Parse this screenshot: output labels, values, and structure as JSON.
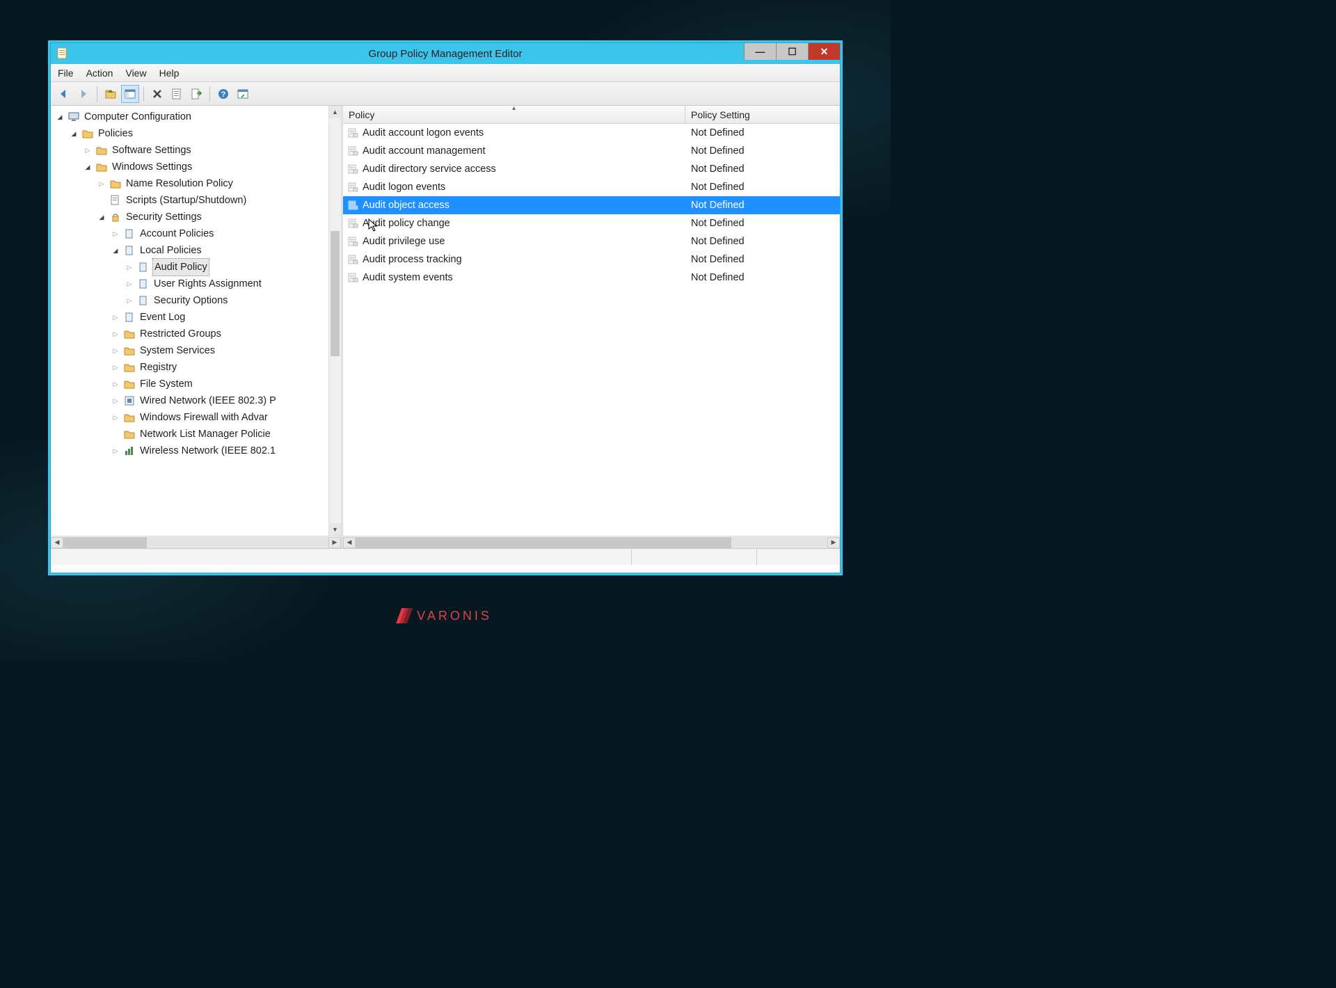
{
  "window": {
    "title": "Group Policy Management Editor"
  },
  "menu": {
    "file": "File",
    "action": "Action",
    "view": "View",
    "help": "Help"
  },
  "tree": {
    "root": "Computer Configuration",
    "policies": "Policies",
    "software": "Software Settings",
    "windows": "Windows Settings",
    "nameres": "Name Resolution Policy",
    "scripts": "Scripts (Startup/Shutdown)",
    "security": "Security Settings",
    "account": "Account Policies",
    "local": "Local Policies",
    "audit": "Audit Policy",
    "userrights": "User Rights Assignment",
    "secoptions": "Security Options",
    "eventlog": "Event Log",
    "restricted": "Restricted Groups",
    "sysservices": "System Services",
    "registry": "Registry",
    "filesystem": "File System",
    "wired": "Wired Network (IEEE 802.3) P",
    "firewall": "Windows Firewall with Advar",
    "netlist": "Network List Manager Policie",
    "wireless": "Wireless Network (IEEE 802.1"
  },
  "list": {
    "header_policy": "Policy",
    "header_setting": "Policy Setting",
    "rows": [
      {
        "name": "Audit account logon events",
        "setting": "Not Defined"
      },
      {
        "name": "Audit account management",
        "setting": "Not Defined"
      },
      {
        "name": "Audit directory service access",
        "setting": "Not Defined"
      },
      {
        "name": "Audit logon events",
        "setting": "Not Defined"
      },
      {
        "name": "Audit object access",
        "setting": "Not Defined"
      },
      {
        "name": "Audit policy change",
        "setting": "Not Defined"
      },
      {
        "name": "Audit privilege use",
        "setting": "Not Defined"
      },
      {
        "name": "Audit process tracking",
        "setting": "Not Defined"
      },
      {
        "name": "Audit system events",
        "setting": "Not Defined"
      }
    ],
    "selected_index": 4
  },
  "branding": {
    "text": "VARONIS"
  }
}
